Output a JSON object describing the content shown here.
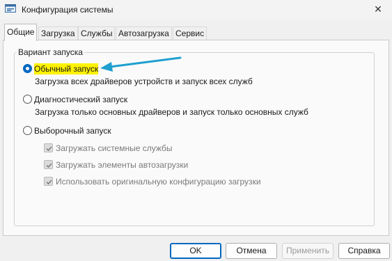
{
  "window": {
    "title": "Конфигурация системы",
    "close_glyph": "✕",
    "icon": "msconfig-icon"
  },
  "tabs": [
    {
      "label": "Общие",
      "active": true
    },
    {
      "label": "Загрузка",
      "active": false
    },
    {
      "label": "Службы",
      "active": false
    },
    {
      "label": "Автозагрузка",
      "active": false
    },
    {
      "label": "Сервис",
      "active": false
    }
  ],
  "startup_group": {
    "label": "Вариант запуска",
    "options": [
      {
        "label": "Обычный запуск",
        "checked": true,
        "highlighted": true,
        "description": "Загрузка всех драйверов устройств и запуск всех служб"
      },
      {
        "label": "Диагностический запуск",
        "checked": false,
        "description": "Загрузка только основных драйверов и запуск только основных служб"
      },
      {
        "label": "Выборочный запуск",
        "checked": false,
        "description": ""
      }
    ],
    "selective_options": [
      {
        "label": "Загружать системные службы",
        "checked": true,
        "disabled": true
      },
      {
        "label": "Загружать элементы автозагрузки",
        "checked": true,
        "disabled": true
      },
      {
        "label": "Использовать оригинальную конфигурацию загрузки",
        "checked": true,
        "disabled": true
      }
    ]
  },
  "buttons": {
    "ok": "OK",
    "cancel": "Отмена",
    "apply": "Применить",
    "help": "Справка"
  },
  "colors": {
    "accent": "#0067c0",
    "highlight": "#fff200",
    "annotation_arrow": "#1e9fcf"
  }
}
